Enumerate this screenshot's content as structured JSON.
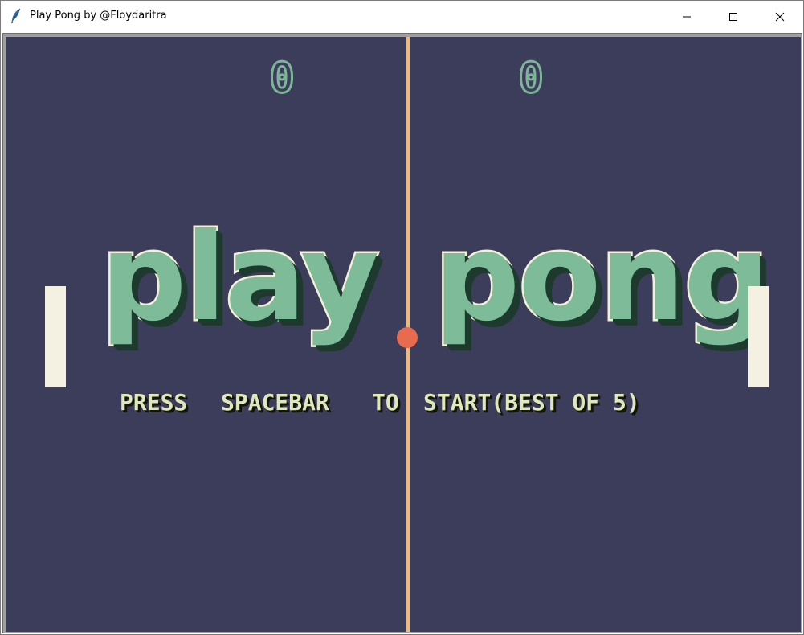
{
  "window": {
    "title": "Play Pong by @Floydaritra",
    "app_icon": "feather-icon",
    "controls": [
      "minimize-icon",
      "maximize-icon",
      "close-icon"
    ]
  },
  "game": {
    "scores": {
      "left": "0",
      "right": "0"
    },
    "logo": {
      "word_left": "play",
      "word_right": "pong"
    },
    "prompt": {
      "press": "PRESS",
      "spacebar": "SPACEBAR",
      "to": "TO",
      "start": "START(BEST OF 5)"
    },
    "colors": {
      "background": "#3c3d5a",
      "center_line": "#efb979",
      "paddle": "#f4f1e2",
      "ball": "#e86b4f",
      "score": "#7db599",
      "logo_fill": "#7dbb99",
      "prompt_text": "#dfe8b8"
    }
  }
}
